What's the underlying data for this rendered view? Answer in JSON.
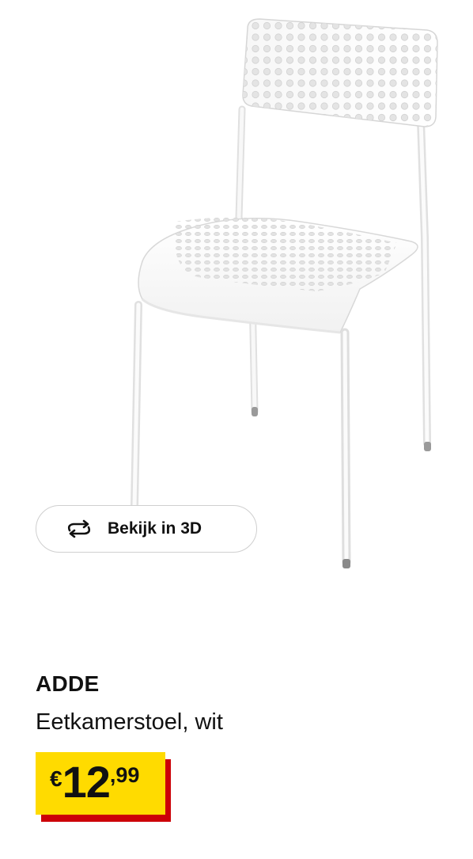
{
  "product": {
    "name": "ADDE",
    "description": "Eetkamerstoel, wit",
    "image_subject": "white chair"
  },
  "viewer": {
    "button_label": "Bekijk in 3D",
    "icon": "rotate-3d-icon"
  },
  "price": {
    "currency": "€",
    "integer": "12",
    "decimals": ",99"
  },
  "colors": {
    "price_tag_background": "#ffdb00",
    "price_tag_shadow": "#cc0008",
    "text": "#111111",
    "button_border": "#cfcfcf"
  }
}
